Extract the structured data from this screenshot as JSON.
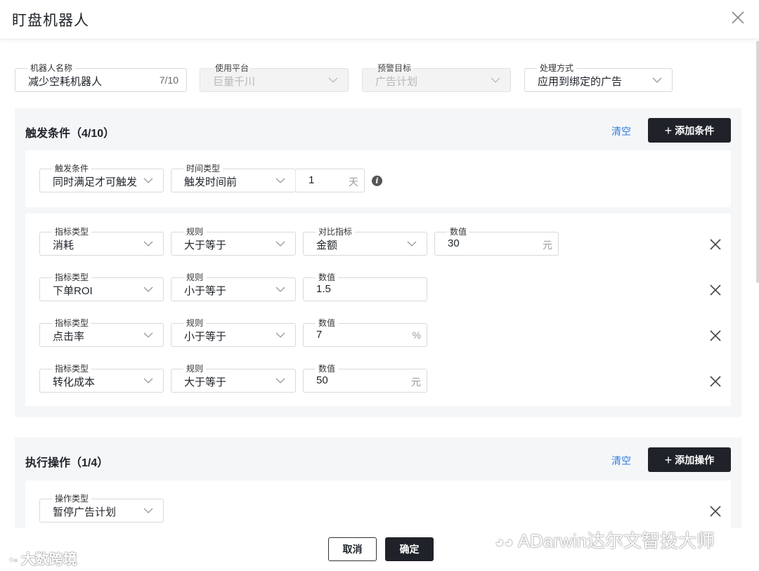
{
  "header": {
    "title": "盯盘机器人"
  },
  "basic": {
    "name": {
      "label": "机器人名称",
      "value": "减少空耗机器人",
      "counter": "7/10"
    },
    "platform": {
      "label": "使用平台",
      "value": "巨量千川"
    },
    "target": {
      "label": "预警目标",
      "value": "广告计划"
    },
    "handling": {
      "label": "处理方式",
      "value": "应用到绑定的广告"
    }
  },
  "trigger": {
    "title": "触发条件（4/10）",
    "clear": "清空",
    "add": "添加条件",
    "mode": {
      "label": "触发条件",
      "value": "同时满足才可触发"
    },
    "time_type": {
      "label": "时间类型",
      "value": "触发时间前"
    },
    "time_amount": {
      "value": "1",
      "unit": "天"
    },
    "rows": [
      {
        "metric_label": "指标类型",
        "metric": "消耗",
        "rule_label": "规则",
        "rule": "大于等于",
        "compare_label": "对比指标",
        "compare": "金额",
        "value_label": "数值",
        "value": "30",
        "unit": "元"
      },
      {
        "metric_label": "指标类型",
        "metric": "下单ROI",
        "rule_label": "规则",
        "rule": "小于等于",
        "value_label": "数值",
        "value": "1.5",
        "unit": ""
      },
      {
        "metric_label": "指标类型",
        "metric": "点击率",
        "rule_label": "规则",
        "rule": "小于等于",
        "value_label": "数值",
        "value": "7",
        "unit": "%"
      },
      {
        "metric_label": "指标类型",
        "metric": "转化成本",
        "rule_label": "规则",
        "rule": "大于等于",
        "value_label": "数值",
        "value": "50",
        "unit": "元"
      }
    ]
  },
  "action": {
    "title": "执行操作（1/4）",
    "clear": "清空",
    "add": "添加操作",
    "op": {
      "label": "操作类型",
      "value": "暂停广告计划"
    }
  },
  "footer": {
    "cancel": "取消",
    "confirm": "确定"
  },
  "watermarks": {
    "left": "大数跨境",
    "right": "ADarwin达尔文智投大师"
  }
}
